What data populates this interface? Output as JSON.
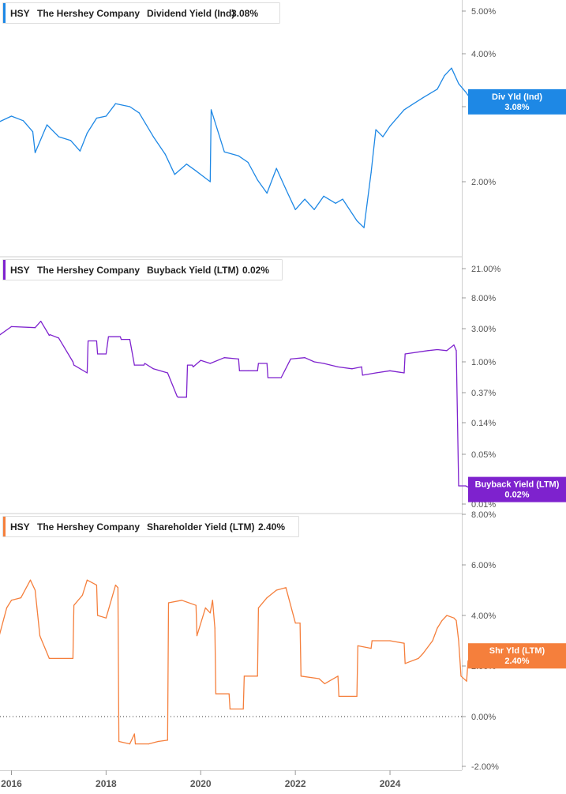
{
  "colors": {
    "dividend": "#1e88e5",
    "buyback": "#7e22ce",
    "shareholder": "#f57f3c",
    "grid": "#d9d9d9",
    "axis_text": "#555555"
  },
  "x_ticks": [
    "2016",
    "2018",
    "2020",
    "2022",
    "2024"
  ],
  "chart_data": [
    {
      "type": "line",
      "ticker": "HSY",
      "company": "The Hershey Company",
      "metric": "Dividend Yield (Ind)",
      "last_value": "3.08%",
      "flag_label": "Div Yld (Ind)",
      "flag_value": "3.08%",
      "scale": "log",
      "y_ticks": [
        "5.00%",
        "4.00%",
        "3.00%",
        "2.00%"
      ],
      "y_tick_values": [
        5,
        4,
        3,
        2
      ],
      "ylim": [
        1.55,
        5.3
      ],
      "x": [
        2015.7,
        2016.0,
        2016.25,
        2016.45,
        2016.5,
        2016.75,
        2017.0,
        2017.25,
        2017.45,
        2017.6,
        2017.8,
        2018.0,
        2018.2,
        2018.5,
        2018.7,
        2019.0,
        2019.25,
        2019.45,
        2019.7,
        2019.9,
        2020.2,
        2020.22,
        2020.5,
        2020.8,
        2021.0,
        2021.2,
        2021.4,
        2021.6,
        2021.8,
        2022.0,
        2022.2,
        2022.4,
        2022.6,
        2022.85,
        2023.0,
        2023.3,
        2023.45,
        2023.6,
        2023.7,
        2023.85,
        2024.0,
        2024.3,
        2024.5,
        2024.7,
        2025.0,
        2025.15,
        2025.3,
        2025.45,
        2025.6,
        2025.75
      ],
      "y": [
        2.75,
        2.85,
        2.78,
        2.62,
        2.34,
        2.72,
        2.55,
        2.5,
        2.36,
        2.6,
        2.82,
        2.85,
        3.05,
        3.0,
        2.9,
        2.55,
        2.32,
        2.08,
        2.2,
        2.12,
        2.0,
        2.95,
        2.35,
        2.3,
        2.22,
        2.02,
        1.88,
        2.15,
        1.92,
        1.72,
        1.82,
        1.72,
        1.85,
        1.78,
        1.82,
        1.62,
        1.56,
        2.1,
        2.65,
        2.55,
        2.7,
        2.95,
        3.05,
        3.15,
        3.3,
        3.55,
        3.7,
        3.4,
        3.25,
        3.08
      ]
    },
    {
      "type": "line",
      "ticker": "HSY",
      "company": "The Hershey Company",
      "metric": "Buyback Yield (LTM)",
      "last_value": "0.02%",
      "flag_label": "Buyback Yield (LTM)",
      "flag_value": "0.02%",
      "scale": "log",
      "y_ticks": [
        "21.00%",
        "8.00%",
        "3.00%",
        "1.00%",
        "0.37%",
        "0.14%",
        "0.05%",
        "0.01%"
      ],
      "y_tick_values": [
        21,
        8,
        3,
        1,
        0.37,
        0.14,
        0.05,
        0.01
      ],
      "ylim": [
        0.01,
        21
      ],
      "x": [
        2015.7,
        2016.0,
        2016.5,
        2016.62,
        2016.8,
        2016.82,
        2017.0,
        2017.3,
        2017.32,
        2017.6,
        2017.62,
        2017.8,
        2017.82,
        2018.0,
        2018.05,
        2018.3,
        2018.32,
        2018.5,
        2018.6,
        2018.8,
        2018.82,
        2019.0,
        2019.3,
        2019.5,
        2019.52,
        2019.7,
        2019.72,
        2019.82,
        2019.84,
        2020.0,
        2020.2,
        2020.5,
        2020.8,
        2020.82,
        2021.0,
        2021.2,
        2021.22,
        2021.4,
        2021.42,
        2021.7,
        2021.9,
        2022.2,
        2022.4,
        2022.6,
        2022.9,
        2023.2,
        2023.4,
        2023.42,
        2023.7,
        2024.0,
        2024.3,
        2024.32,
        2024.8,
        2025.0,
        2025.2,
        2025.35,
        2025.4,
        2025.45,
        2025.6,
        2025.75
      ],
      "y": [
        2.3,
        3.2,
        3.1,
        3.8,
        2.4,
        2.45,
        2.2,
        1.0,
        0.9,
        0.7,
        2.0,
        2.0,
        1.3,
        1.3,
        2.3,
        2.3,
        2.1,
        2.1,
        0.9,
        0.9,
        0.95,
        0.8,
        0.7,
        0.33,
        0.32,
        0.32,
        0.9,
        0.9,
        0.85,
        1.05,
        0.95,
        1.15,
        1.1,
        0.75,
        0.75,
        0.75,
        0.95,
        0.95,
        0.6,
        0.6,
        1.1,
        1.15,
        1.0,
        0.95,
        0.85,
        0.8,
        0.85,
        0.65,
        0.7,
        0.75,
        0.7,
        1.3,
        1.45,
        1.5,
        1.45,
        1.75,
        1.45,
        0.018,
        0.018,
        0.016
      ]
    },
    {
      "type": "line",
      "ticker": "HSY",
      "company": "The Hershey Company",
      "metric": "Shareholder Yield (LTM)",
      "last_value": "2.40%",
      "flag_label": "Shr Yld (LTM)",
      "flag_value": "2.40%",
      "scale": "linear",
      "y_ticks": [
        "8.00%",
        "6.00%",
        "4.00%",
        "2.00%",
        "0.00%",
        "-2.00%"
      ],
      "y_tick_values": [
        8,
        6,
        4,
        2,
        0,
        -2
      ],
      "ylim": [
        -2,
        8
      ],
      "zero_line": true,
      "x": [
        2015.7,
        2015.9,
        2016.0,
        2016.2,
        2016.4,
        2016.5,
        2016.6,
        2016.62,
        2016.8,
        2016.82,
        2017.3,
        2017.32,
        2017.5,
        2017.6,
        2017.8,
        2017.82,
        2018.0,
        2018.2,
        2018.25,
        2018.27,
        2018.5,
        2018.6,
        2018.62,
        2018.9,
        2019.1,
        2019.3,
        2019.32,
        2019.6,
        2019.9,
        2019.92,
        2020.1,
        2020.2,
        2020.25,
        2020.3,
        2020.32,
        2020.6,
        2020.62,
        2020.9,
        2020.92,
        2021.2,
        2021.22,
        2021.4,
        2021.6,
        2021.8,
        2022.0,
        2022.1,
        2022.12,
        2022.5,
        2022.62,
        2022.9,
        2022.92,
        2023.3,
        2023.32,
        2023.6,
        2023.62,
        2024.0,
        2024.3,
        2024.32,
        2024.6,
        2024.7,
        2024.9,
        2025.0,
        2025.1,
        2025.2,
        2025.35,
        2025.4,
        2025.45,
        2025.5,
        2025.62,
        2025.65,
        2025.75
      ],
      "y": [
        2.9,
        4.3,
        4.6,
        4.7,
        5.4,
        5.0,
        3.2,
        3.1,
        2.3,
        2.3,
        2.3,
        4.4,
        4.8,
        5.4,
        5.2,
        4.0,
        3.9,
        5.2,
        5.1,
        -1.0,
        -1.1,
        -0.7,
        -1.1,
        -1.1,
        -1.0,
        -0.95,
        4.5,
        4.6,
        4.4,
        3.2,
        4.3,
        4.1,
        4.6,
        3.5,
        0.9,
        0.9,
        0.3,
        0.3,
        1.6,
        1.6,
        4.3,
        4.7,
        5.0,
        5.1,
        3.7,
        3.7,
        1.6,
        1.5,
        1.3,
        1.6,
        0.8,
        0.8,
        2.8,
        2.7,
        3.0,
        3.0,
        2.9,
        2.1,
        2.3,
        2.5,
        3.0,
        3.5,
        3.8,
        4.0,
        3.9,
        3.8,
        3.0,
        1.6,
        1.4,
        2.2,
        2.4
      ]
    }
  ]
}
